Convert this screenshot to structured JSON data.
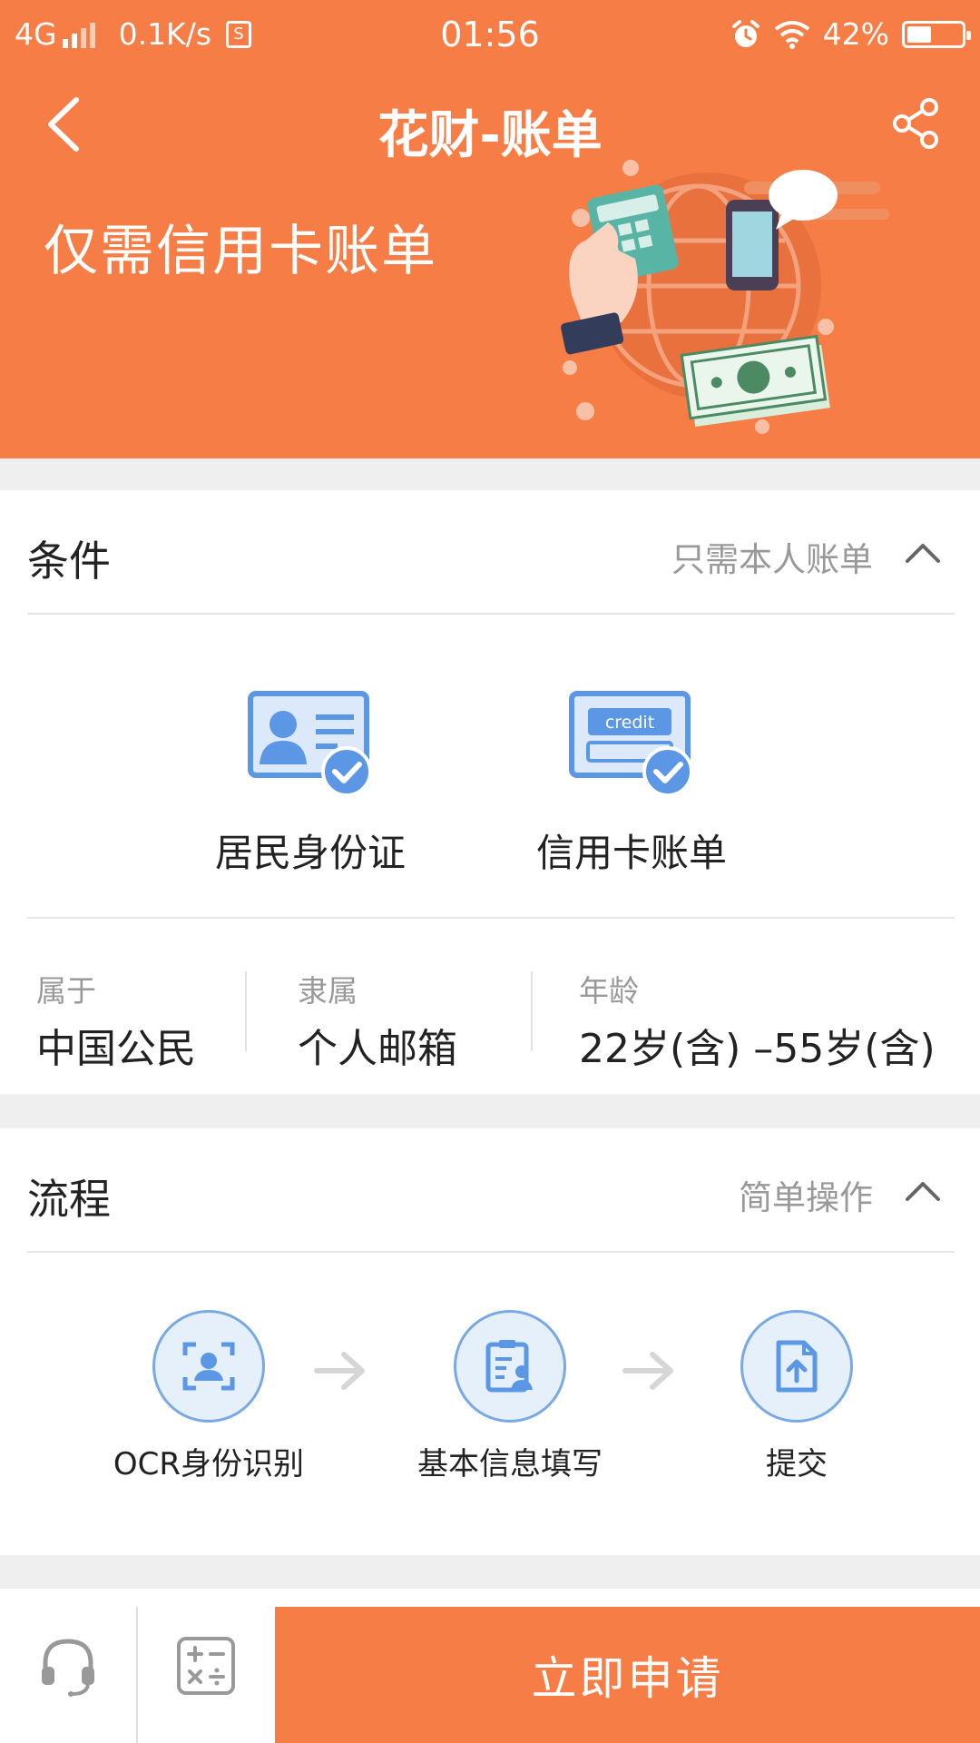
{
  "status_bar": {
    "network": "4G",
    "speed": "0.1K/s",
    "sim_icon": "S",
    "time": "01:56",
    "battery": "42%",
    "battery_level": 0.42
  },
  "header": {
    "title": "花财-账单",
    "banner_text": "仅需信用卡账单"
  },
  "conditions": {
    "title": "条件",
    "subtitle": "只需本人账单",
    "items": [
      {
        "label": "居民身份证",
        "icon": "id-card-check-icon"
      },
      {
        "label": "信用卡账单",
        "icon": "credit-card-check-icon",
        "card_text": "credit"
      }
    ],
    "meta": [
      {
        "key": "属于",
        "value": "中国公民"
      },
      {
        "key": "隶属",
        "value": "个人邮箱"
      },
      {
        "key": "年龄",
        "value": "22岁(含) –55岁(含)"
      }
    ]
  },
  "process": {
    "title": "流程",
    "subtitle": "简单操作",
    "steps": [
      {
        "label": "OCR身份识别",
        "icon": "face-scan-icon"
      },
      {
        "label": "基本信息填写",
        "icon": "form-person-icon"
      },
      {
        "label": "提交",
        "icon": "upload-document-icon"
      }
    ]
  },
  "bottom_bar": {
    "apply_label": "立即申请"
  },
  "colors": {
    "brand_orange": "#f67d45",
    "accent_blue": "#5b97e5",
    "step_circle_bg": "#e6f0fb"
  }
}
